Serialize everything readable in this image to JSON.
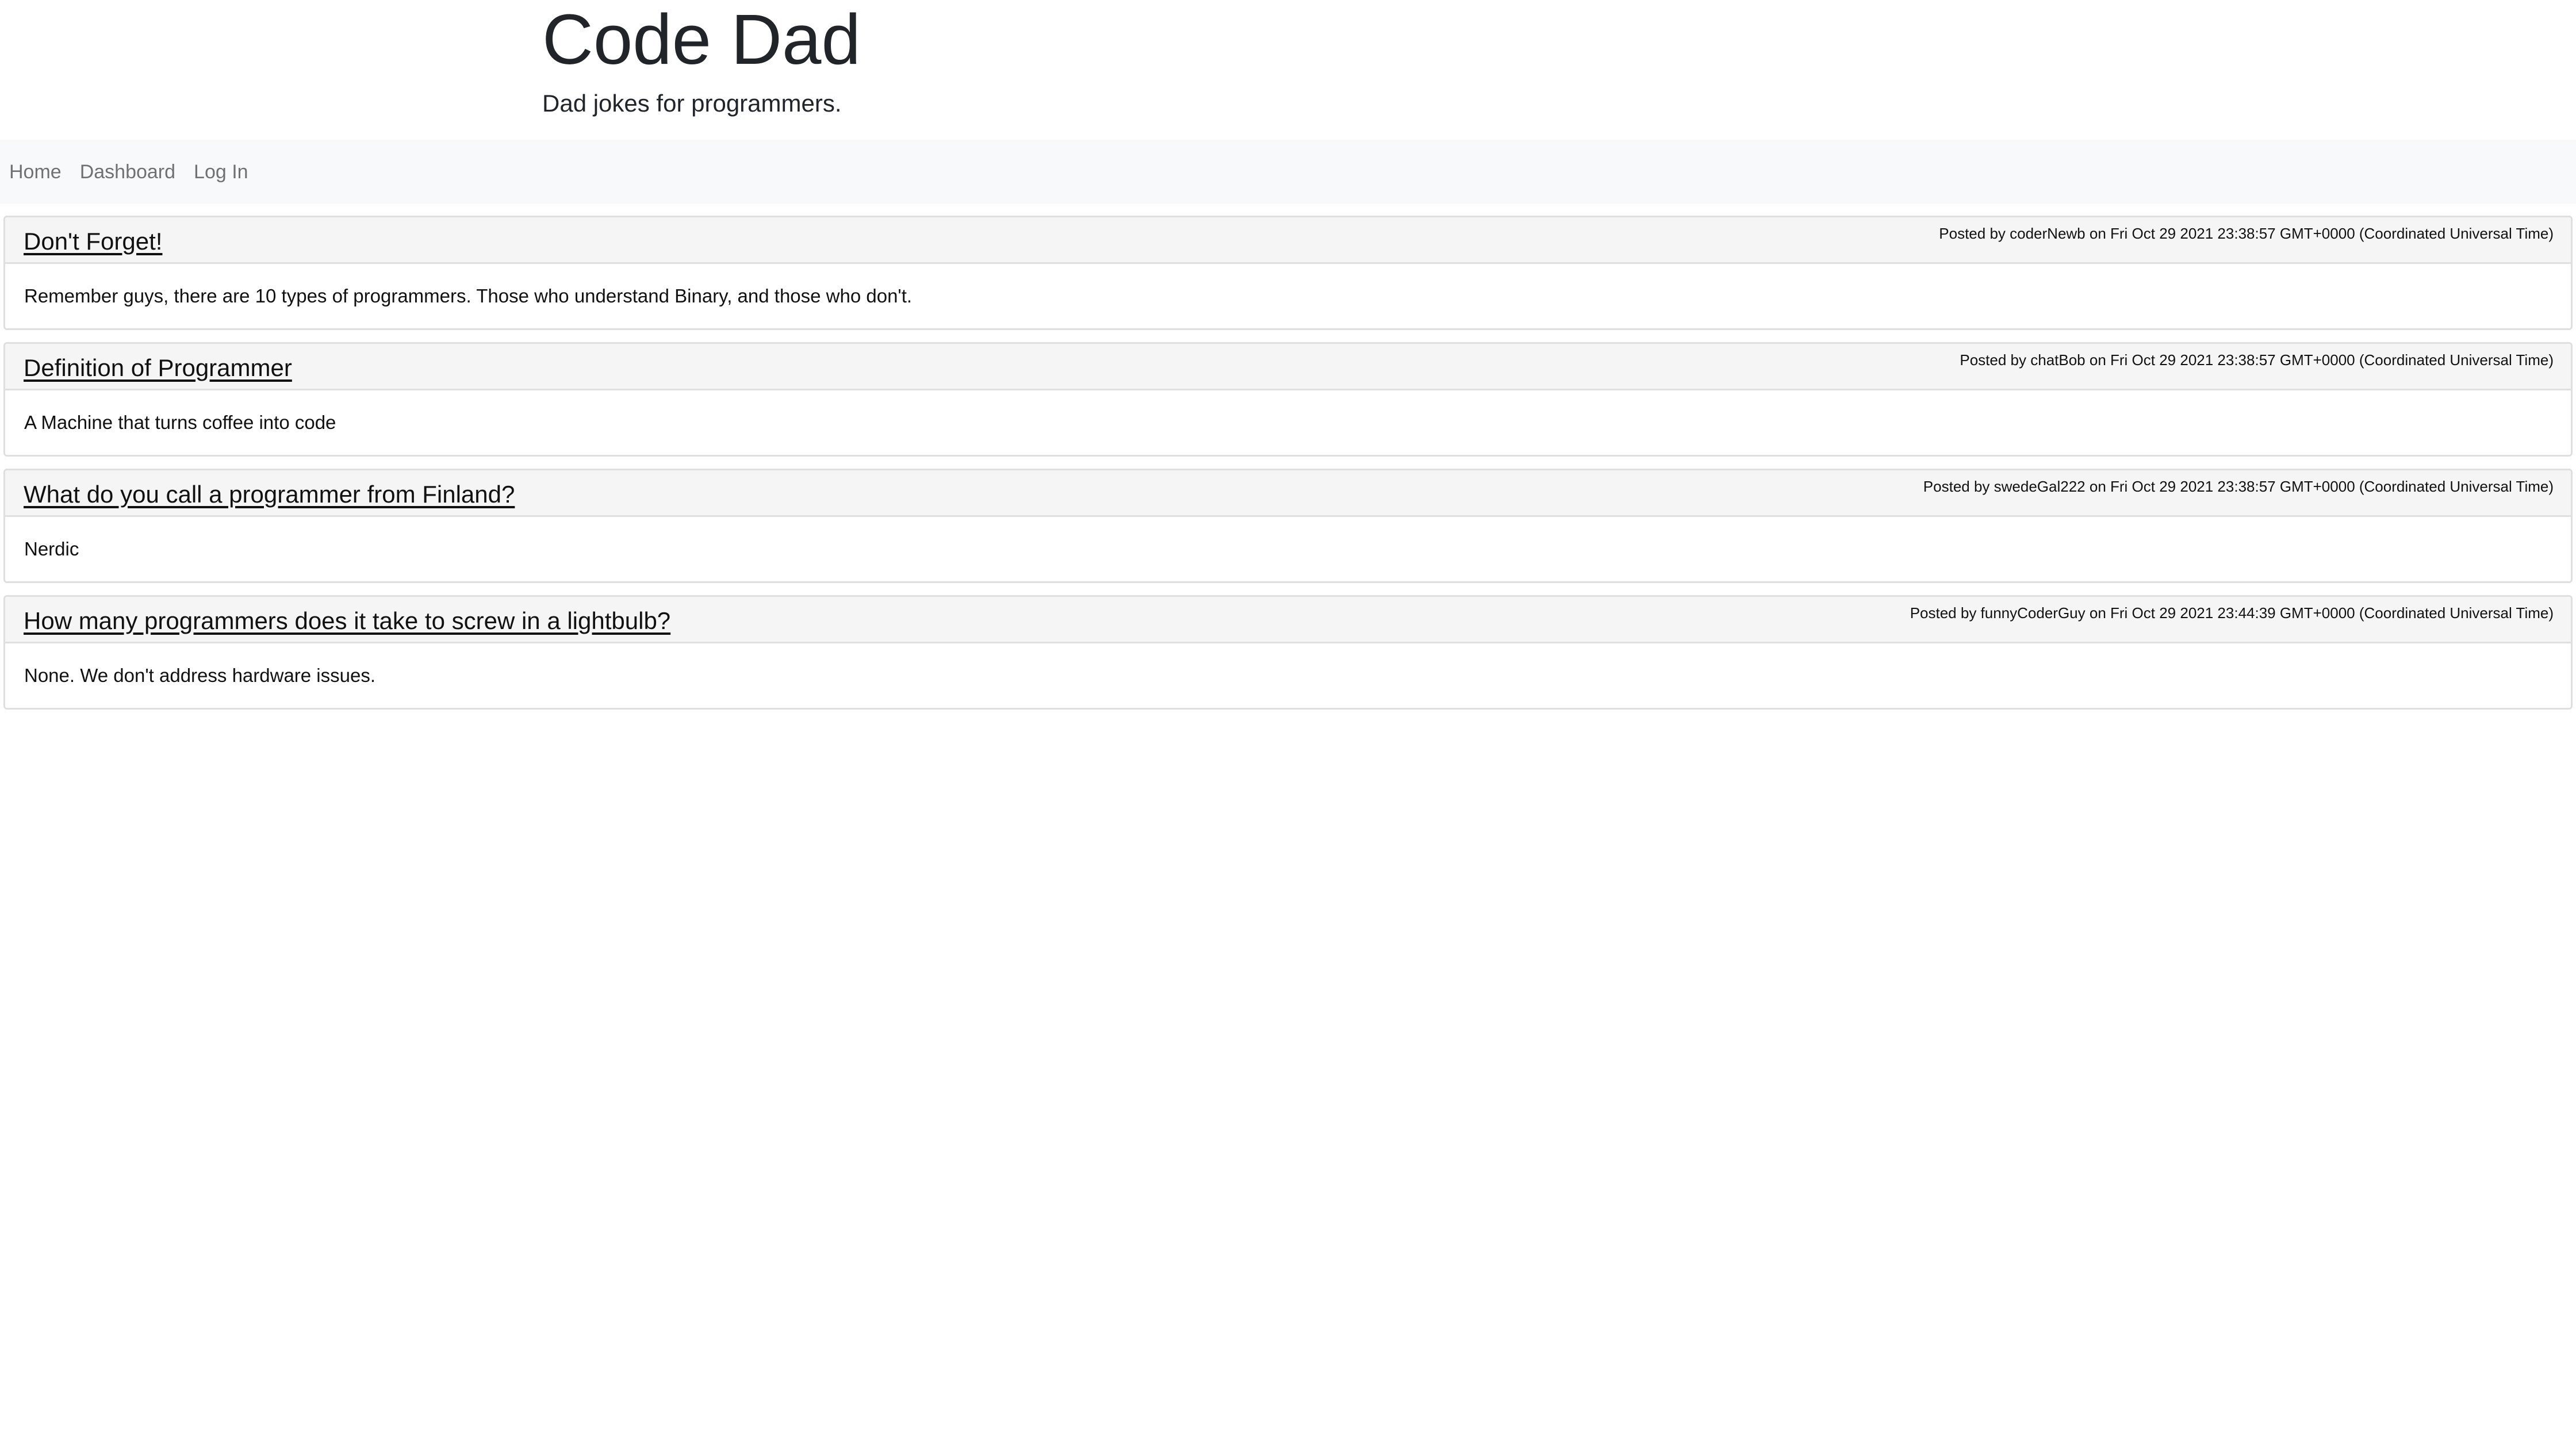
{
  "header": {
    "title": "Code Dad",
    "tagline": "Dad jokes for programmers."
  },
  "nav": {
    "items": [
      {
        "label": "Home"
      },
      {
        "label": "Dashboard"
      },
      {
        "label": "Log In"
      }
    ]
  },
  "posts": [
    {
      "title": "Don't Forget!",
      "meta": "Posted by coderNewb on Fri Oct 29 2021 23:38:57 GMT+0000 (Coordinated Universal Time)",
      "body": "Remember guys, there are 10 types of programmers. Those who understand Binary, and those who don't."
    },
    {
      "title": "Definition of Programmer",
      "meta": "Posted by chatBob on Fri Oct 29 2021 23:38:57 GMT+0000 (Coordinated Universal Time)",
      "body": "A Machine that turns coffee into code"
    },
    {
      "title": "What do you call a programmer from Finland?",
      "meta": "Posted by swedeGal222 on Fri Oct 29 2021 23:38:57 GMT+0000 (Coordinated Universal Time)",
      "body": "Nerdic"
    },
    {
      "title": "How many programmers does it take to screw in a lightbulb?",
      "meta": "Posted by funnyCoderGuy on Fri Oct 29 2021 23:44:39 GMT+0000 (Coordinated Universal Time)",
      "body": "None. We don't address hardware issues."
    }
  ]
}
